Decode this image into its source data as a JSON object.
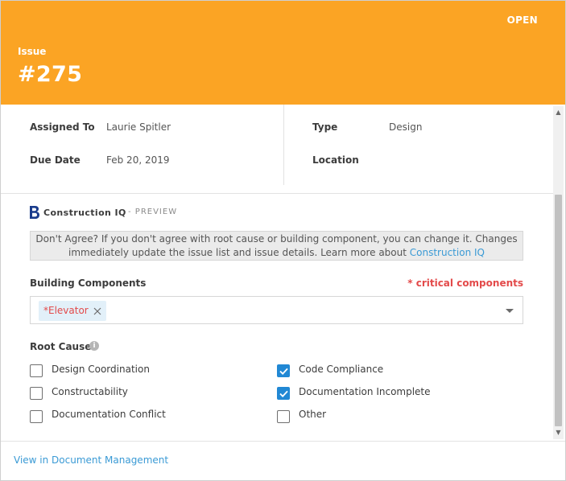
{
  "header": {
    "status": "OPEN",
    "issue_label": "Issue",
    "issue_number": "#275",
    "color": "#fba424"
  },
  "details": {
    "assigned_to_label": "Assigned To",
    "assigned_to_value": "Laurie Spitler",
    "due_date_label": "Due Date",
    "due_date_value": "Feb 20, 2019",
    "type_label": "Type",
    "type_value": "Design",
    "location_label": "Location",
    "location_value": ""
  },
  "construction_iq": {
    "title": "Construction IQ",
    "preview": "- PREVIEW",
    "note_line1": "Don't Agree? If you don't agree with root cause or building component, you can change it. Changes",
    "note_line2_prefix": "immediately update the issue list and issue details. Learn more about ",
    "note_link": "Construction IQ"
  },
  "building_components": {
    "label": "Building Components",
    "critical_note": "* critical components",
    "selected_tag": "*Elevator"
  },
  "root_cause": {
    "label": "Root Cause",
    "info_icon": "info-icon",
    "options": [
      {
        "label": "Design Coordination",
        "checked": false
      },
      {
        "label": "Code Compliance",
        "checked": true
      },
      {
        "label": "Constructability",
        "checked": false
      },
      {
        "label": "Documentation Incomplete",
        "checked": true
      },
      {
        "label": "Documentation Conflict",
        "checked": false
      },
      {
        "label": "Other",
        "checked": false
      }
    ]
  },
  "footer": {
    "link": "View in Document Management"
  },
  "colors": {
    "accent_blue": "#2188d4",
    "link_blue": "#3a9ad5",
    "critical_red": "#e34a4a"
  }
}
